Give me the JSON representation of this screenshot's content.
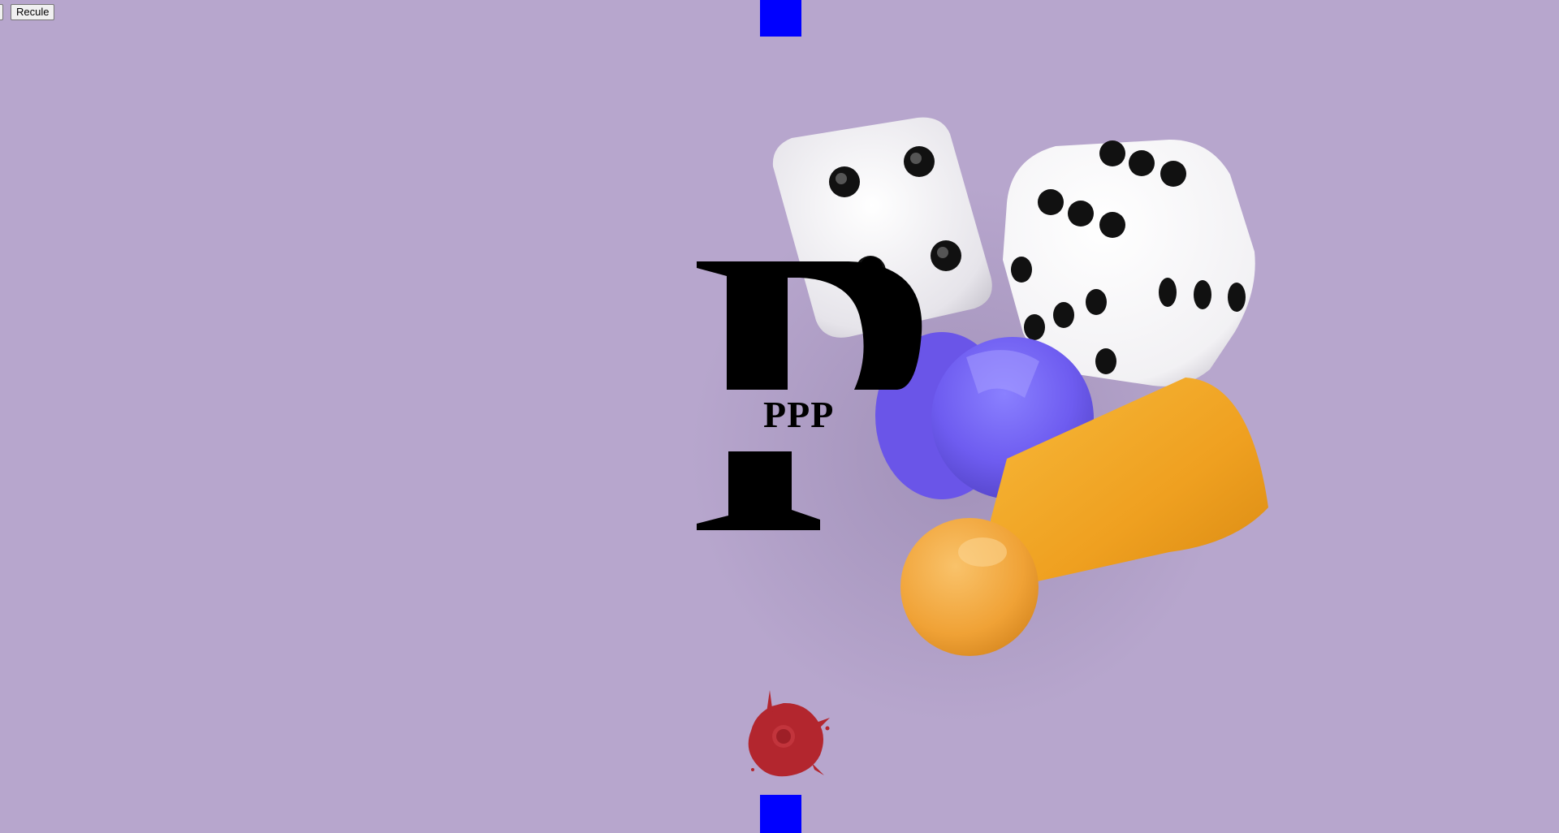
{
  "toolbar": {
    "edge_button_label": "",
    "recule_label": "Recule"
  },
  "game": {
    "logo_letter": "P",
    "logo_subtitle": "PPP",
    "paddle_color": "#0000ff",
    "ball_color": "#b3262e",
    "background_color": "#b7a6cd"
  },
  "decor": {
    "icons": [
      "die-icon",
      "die-icon",
      "pawn-purple-icon",
      "pawn-orange-icon"
    ]
  }
}
